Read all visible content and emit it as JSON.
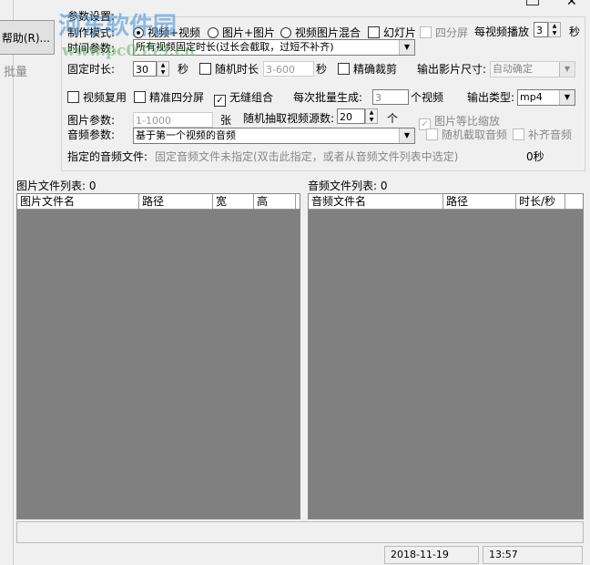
{
  "left_panel": {
    "help": "帮助(R)...",
    "batch": "批量"
  },
  "params": {
    "group_title": "参数设置:",
    "mode_label": "制作模式:",
    "modes": [
      "视频+视频",
      "图片+图片",
      "视频图片混合"
    ],
    "slideshow": "幻灯片",
    "quad": "四分屏",
    "per_video_label": "每视频播放",
    "per_video_value": "3",
    "per_video_unit": "秒",
    "time_label": "时间参数:",
    "time_value": "所有视频固定时长(过长会截取，过短不补齐)",
    "fixed_label": "固定时长:",
    "fixed_value": "30",
    "fixed_unit": "秒",
    "random_dur": "随机时长",
    "random_dur_value": "3-600",
    "random_dur_unit": "秒",
    "precise_cut": "精确裁剪",
    "size_label": "输出影片尺寸:",
    "size_value": "自动确定",
    "reuse": "视频复用",
    "precise_quad": "精准四分屏",
    "seamless": "无缝组合",
    "batch_label": "每次批量生成:",
    "batch_value": "3",
    "batch_unit": "个视频",
    "type_label": "输出类型:",
    "type_value": "mp4",
    "image_label": "图片参数:",
    "image_value": "1-1000",
    "image_unit": "张",
    "random_src_label": "随机抽取视频源数:",
    "random_src_value": "20",
    "random_src_unit": "个",
    "scale": "图片等比缩放",
    "audio_label": "音频参数:",
    "audio_value": "基于第一个视频的音频",
    "random_audio": "随机截取音频",
    "fill_audio": "补齐音频",
    "audio_file_label": "指定的音频文件:",
    "audio_file_value": "固定音频文件未指定(双击此指定，或者从音频文件列表中选定)",
    "audio_duration": "0秒"
  },
  "image_list": {
    "title": "图片文件列表: 0",
    "columns": [
      "图片文件名",
      "路径",
      "宽",
      "高"
    ]
  },
  "audio_list": {
    "title": "音频文件列表: 0",
    "columns": [
      "音频文件名",
      "路径",
      "时长/秒"
    ]
  },
  "status": {
    "date": "2018-11-19",
    "time": "13:57"
  },
  "watermark": {
    "name": "河东软件园",
    "url": "www.pc0359.cn"
  }
}
